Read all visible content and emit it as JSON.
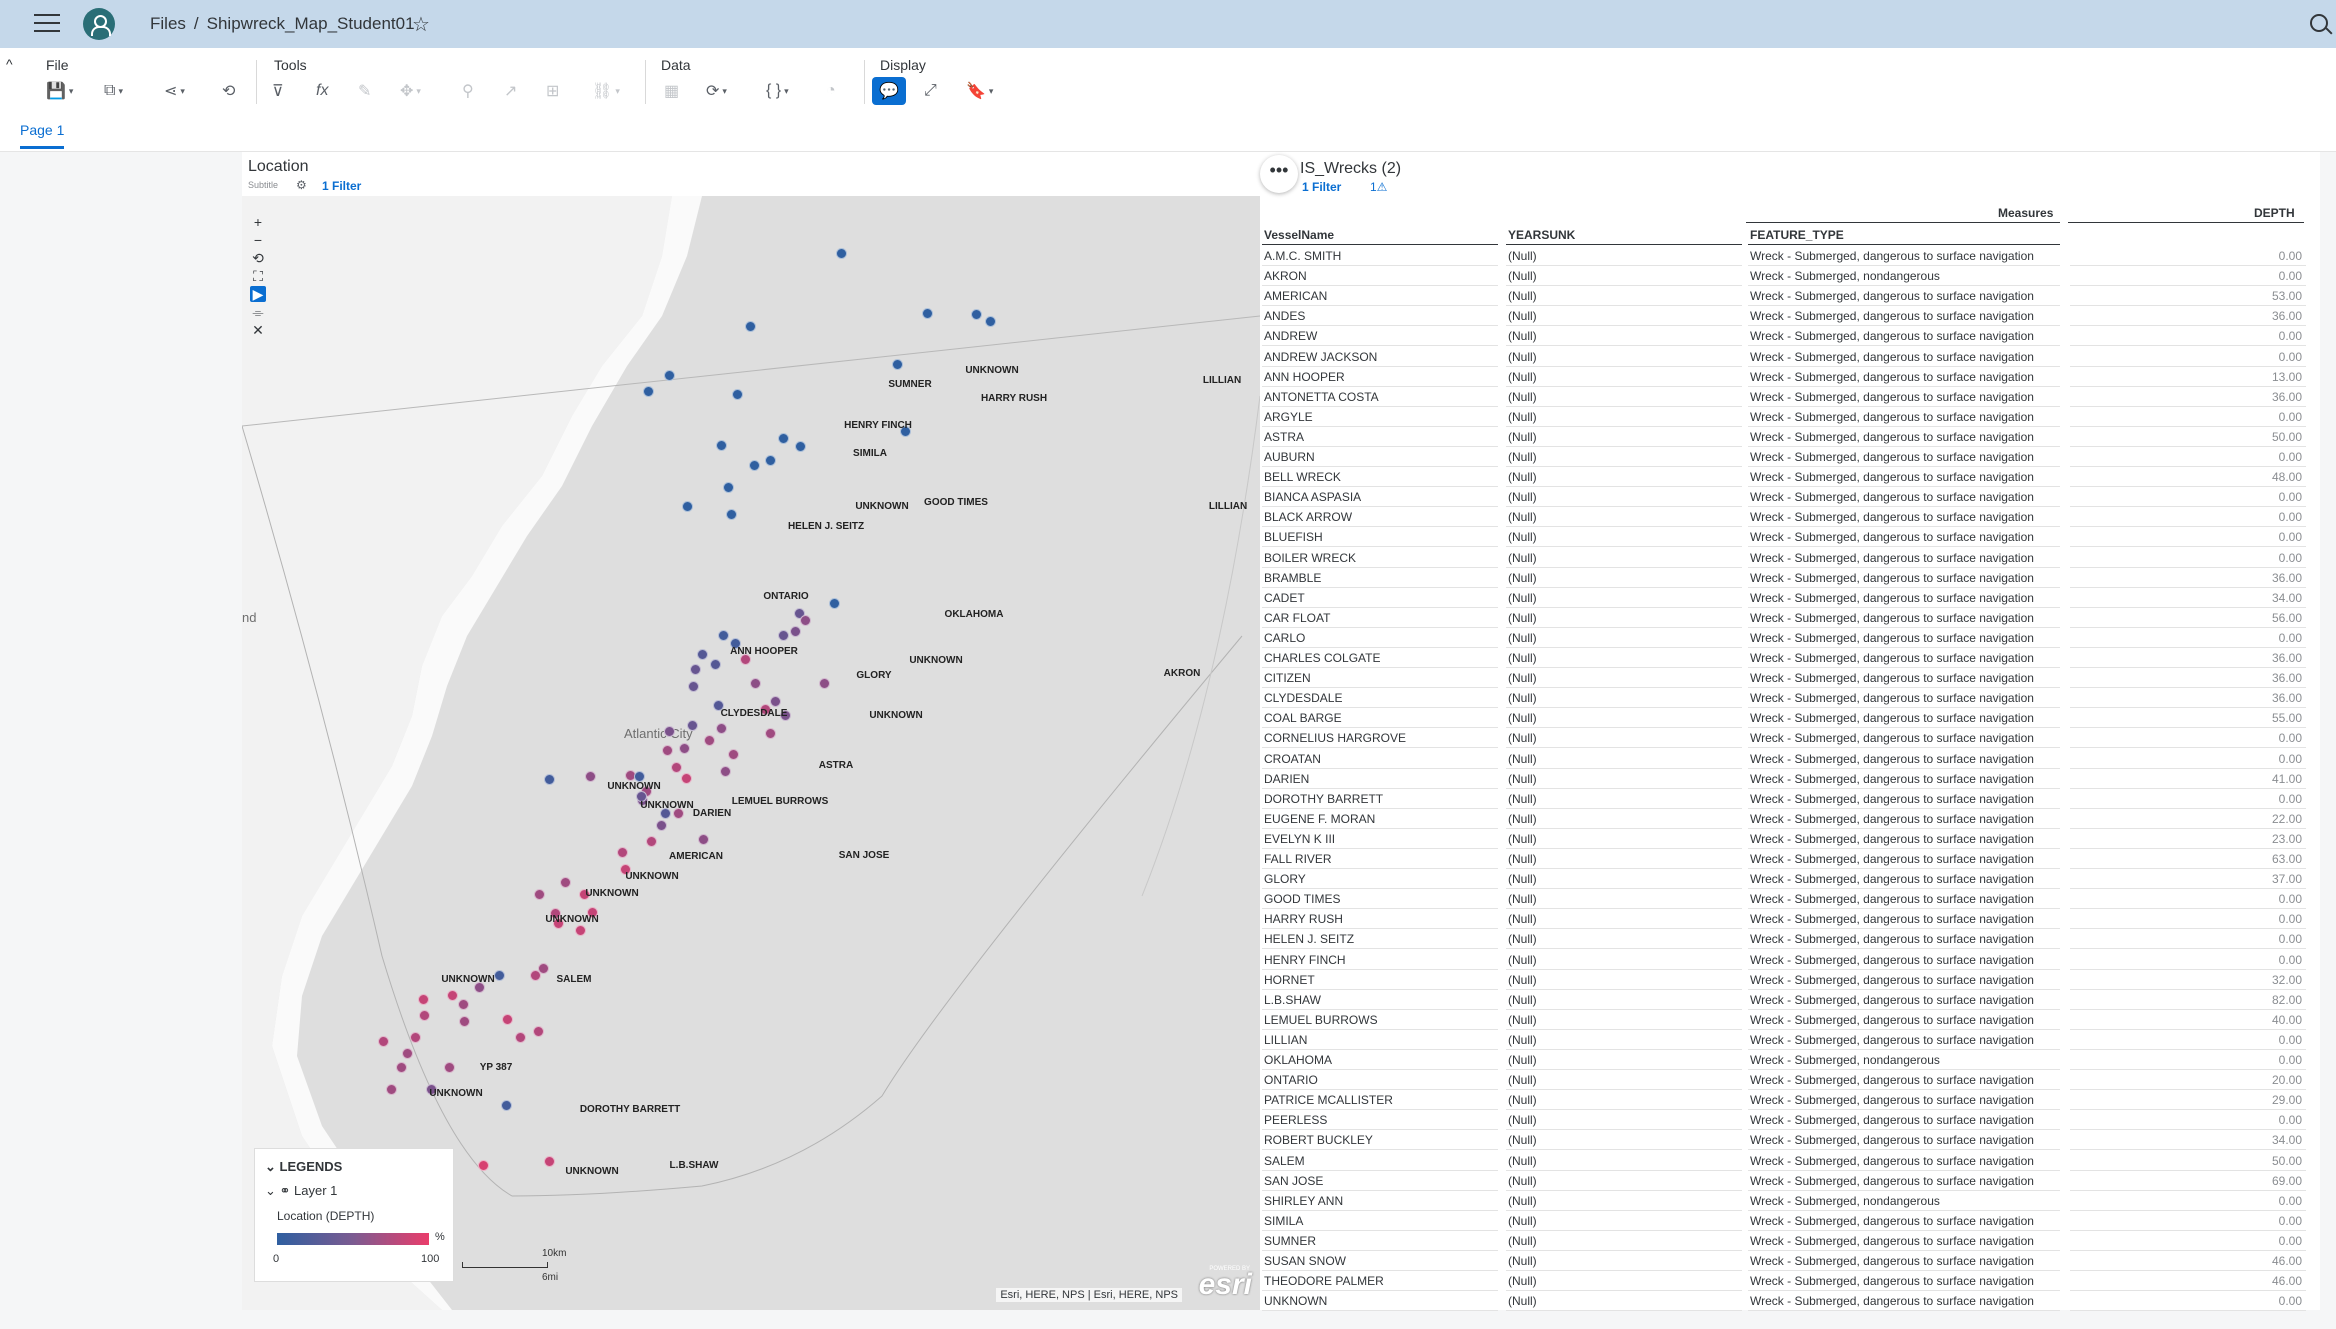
{
  "shell": {
    "files": "Files",
    "separator": "/",
    "doc_title": "Shipwreck_Map_Student01"
  },
  "toolbar": {
    "groups": {
      "file": "File",
      "tools": "Tools",
      "data": "Data",
      "display": "Display"
    }
  },
  "tabs": [
    {
      "label": "Page 1"
    }
  ],
  "map": {
    "title": "Location",
    "subtitle": "Subtitle",
    "filter_label": "1 Filter",
    "city_label": "Atlantic City",
    "edge_label": "nd",
    "legend": {
      "title": "LEGENDS",
      "layer": "Layer 1",
      "measure": "Location (DEPTH)",
      "unit": "%",
      "min": "0",
      "max": "100"
    },
    "scale": {
      "km": "10km",
      "mi": "6mi"
    },
    "attribution": "Esri, HERE, NPS | Esri, HERE, NPS",
    "esri_powered": "POWERED BY",
    "esri_logo": "esri",
    "color_low": "#2f5fa0",
    "color_high": "#ea3d6b",
    "labels": [
      {
        "t": "UNKNOWN"
      },
      {
        "t": "SUMNER"
      },
      {
        "t": "HARRY RUSH"
      },
      {
        "t": "LILLIAN"
      },
      {
        "t": "HENRY FINCH"
      },
      {
        "t": "SIMILA"
      },
      {
        "t": "UNKNOWN"
      },
      {
        "t": "GOOD TIMES"
      },
      {
        "t": "LILLIAN"
      },
      {
        "t": "HELEN J. SEITZ"
      },
      {
        "t": "ONTARIO"
      },
      {
        "t": "OKLAHOMA"
      },
      {
        "t": "ANN HOOPER"
      },
      {
        "t": "GLORY"
      },
      {
        "t": "UNKNOWN"
      },
      {
        "t": "AKRON"
      },
      {
        "t": "UNKNOWN"
      },
      {
        "t": "CLYDESDALE"
      },
      {
        "t": "ASTRA"
      },
      {
        "t": "UNKNOWN"
      },
      {
        "t": "UNKNOWN"
      },
      {
        "t": "DARIEN"
      },
      {
        "t": "LEMUEL BURROWS"
      },
      {
        "t": "SAN JOSE"
      },
      {
        "t": "AMERICAN"
      },
      {
        "t": "UNKNOWN"
      },
      {
        "t": "UNKNOWN"
      },
      {
        "t": "UNKNOWN"
      },
      {
        "t": "UNKNOWN"
      },
      {
        "t": "SALEM"
      },
      {
        "t": "YP 387"
      },
      {
        "t": "UNKNOWN"
      },
      {
        "t": "DOROTHY BARRETT"
      },
      {
        "t": "UNKNOWN"
      },
      {
        "t": "L.B.SHAW"
      }
    ]
  },
  "table": {
    "title": "IS_Wrecks (2)",
    "filter_label": "1 Filter",
    "warning_label": "1⚠",
    "measures_label": "Measures",
    "columns": [
      "VesselName",
      "YEARSUNK",
      "FEATURE_TYPE",
      "DEPTH"
    ],
    "rows": [
      [
        "A.M.C. SMITH",
        "(Null)",
        "Wreck - Submerged, dangerous to surface navigation",
        "0.00"
      ],
      [
        "AKRON",
        "(Null)",
        "Wreck - Submerged, nondangerous",
        "0.00"
      ],
      [
        "AMERICAN",
        "(Null)",
        "Wreck - Submerged, dangerous to surface navigation",
        "53.00"
      ],
      [
        "ANDES",
        "(Null)",
        "Wreck - Submerged, dangerous to surface navigation",
        "36.00"
      ],
      [
        "ANDREW",
        "(Null)",
        "Wreck - Submerged, dangerous to surface navigation",
        "0.00"
      ],
      [
        "ANDREW JACKSON",
        "(Null)",
        "Wreck - Submerged, dangerous to surface navigation",
        "0.00"
      ],
      [
        "ANN HOOPER",
        "(Null)",
        "Wreck - Submerged, dangerous to surface navigation",
        "13.00"
      ],
      [
        "ANTONETTA COSTA",
        "(Null)",
        "Wreck - Submerged, dangerous to surface navigation",
        "36.00"
      ],
      [
        "ARGYLE",
        "(Null)",
        "Wreck - Submerged, dangerous to surface navigation",
        "0.00"
      ],
      [
        "ASTRA",
        "(Null)",
        "Wreck - Submerged, dangerous to surface navigation",
        "50.00"
      ],
      [
        "AUBURN",
        "(Null)",
        "Wreck - Submerged, dangerous to surface navigation",
        "0.00"
      ],
      [
        "BELL WRECK",
        "(Null)",
        "Wreck - Submerged, dangerous to surface navigation",
        "48.00"
      ],
      [
        "BIANCA ASPASIA",
        "(Null)",
        "Wreck - Submerged, dangerous to surface navigation",
        "0.00"
      ],
      [
        "BLACK ARROW",
        "(Null)",
        "Wreck - Submerged, dangerous to surface navigation",
        "0.00"
      ],
      [
        "BLUEFISH",
        "(Null)",
        "Wreck - Submerged, dangerous to surface navigation",
        "0.00"
      ],
      [
        "BOILER WRECK",
        "(Null)",
        "Wreck - Submerged, dangerous to surface navigation",
        "0.00"
      ],
      [
        "BRAMBLE",
        "(Null)",
        "Wreck - Submerged, dangerous to surface navigation",
        "36.00"
      ],
      [
        "CADET",
        "(Null)",
        "Wreck - Submerged, dangerous to surface navigation",
        "34.00"
      ],
      [
        "CAR FLOAT",
        "(Null)",
        "Wreck - Submerged, dangerous to surface navigation",
        "56.00"
      ],
      [
        "CARLO",
        "(Null)",
        "Wreck - Submerged, dangerous to surface navigation",
        "0.00"
      ],
      [
        "CHARLES COLGATE",
        "(Null)",
        "Wreck - Submerged, dangerous to surface navigation",
        "36.00"
      ],
      [
        "CITIZEN",
        "(Null)",
        "Wreck - Submerged, dangerous to surface navigation",
        "36.00"
      ],
      [
        "CLYDESDALE",
        "(Null)",
        "Wreck - Submerged, dangerous to surface navigation",
        "36.00"
      ],
      [
        "COAL BARGE",
        "(Null)",
        "Wreck - Submerged, dangerous to surface navigation",
        "55.00"
      ],
      [
        "CORNELIUS HARGROVE",
        "(Null)",
        "Wreck - Submerged, dangerous to surface navigation",
        "0.00"
      ],
      [
        "CROATAN",
        "(Null)",
        "Wreck - Submerged, dangerous to surface navigation",
        "0.00"
      ],
      [
        "DARIEN",
        "(Null)",
        "Wreck - Submerged, dangerous to surface navigation",
        "41.00"
      ],
      [
        "DOROTHY BARRETT",
        "(Null)",
        "Wreck - Submerged, dangerous to surface navigation",
        "0.00"
      ],
      [
        "EUGENE F. MORAN",
        "(Null)",
        "Wreck - Submerged, dangerous to surface navigation",
        "22.00"
      ],
      [
        "EVELYN K III",
        "(Null)",
        "Wreck - Submerged, dangerous to surface navigation",
        "23.00"
      ],
      [
        "FALL RIVER",
        "(Null)",
        "Wreck - Submerged, dangerous to surface navigation",
        "63.00"
      ],
      [
        "GLORY",
        "(Null)",
        "Wreck - Submerged, dangerous to surface navigation",
        "37.00"
      ],
      [
        "GOOD TIMES",
        "(Null)",
        "Wreck - Submerged, dangerous to surface navigation",
        "0.00"
      ],
      [
        "HARRY RUSH",
        "(Null)",
        "Wreck - Submerged, dangerous to surface navigation",
        "0.00"
      ],
      [
        "HELEN J. SEITZ",
        "(Null)",
        "Wreck - Submerged, dangerous to surface navigation",
        "0.00"
      ],
      [
        "HENRY FINCH",
        "(Null)",
        "Wreck - Submerged, dangerous to surface navigation",
        "0.00"
      ],
      [
        "HORNET",
        "(Null)",
        "Wreck - Submerged, dangerous to surface navigation",
        "32.00"
      ],
      [
        "L.B.SHAW",
        "(Null)",
        "Wreck - Submerged, dangerous to surface navigation",
        "82.00"
      ],
      [
        "LEMUEL BURROWS",
        "(Null)",
        "Wreck - Submerged, dangerous to surface navigation",
        "40.00"
      ],
      [
        "LILLIAN",
        "(Null)",
        "Wreck - Submerged, dangerous to surface navigation",
        "0.00"
      ],
      [
        "OKLAHOMA",
        "(Null)",
        "Wreck - Submerged, nondangerous",
        "0.00"
      ],
      [
        "ONTARIO",
        "(Null)",
        "Wreck - Submerged, dangerous to surface navigation",
        "20.00"
      ],
      [
        "PATRICE MCALLISTER",
        "(Null)",
        "Wreck - Submerged, dangerous to surface navigation",
        "29.00"
      ],
      [
        "PEERLESS",
        "(Null)",
        "Wreck - Submerged, dangerous to surface navigation",
        "0.00"
      ],
      [
        "ROBERT BUCKLEY",
        "(Null)",
        "Wreck - Submerged, dangerous to surface navigation",
        "34.00"
      ],
      [
        "SALEM",
        "(Null)",
        "Wreck - Submerged, dangerous to surface navigation",
        "50.00"
      ],
      [
        "SAN JOSE",
        "(Null)",
        "Wreck - Submerged, dangerous to surface navigation",
        "69.00"
      ],
      [
        "SHIRLEY ANN",
        "(Null)",
        "Wreck - Submerged, nondangerous",
        "0.00"
      ],
      [
        "SIMILA",
        "(Null)",
        "Wreck - Submerged, dangerous to surface navigation",
        "0.00"
      ],
      [
        "SUMNER",
        "(Null)",
        "Wreck - Submerged, dangerous to surface navigation",
        "0.00"
      ],
      [
        "SUSAN SNOW",
        "(Null)",
        "Wreck - Submerged, dangerous to surface navigation",
        "46.00"
      ],
      [
        "THEODORE PALMER",
        "(Null)",
        "Wreck - Submerged, dangerous to surface navigation",
        "46.00"
      ],
      [
        "UNKNOWN",
        "(Null)",
        "Wreck - Submerged, dangerous to surface navigation",
        "0.00"
      ]
    ]
  }
}
